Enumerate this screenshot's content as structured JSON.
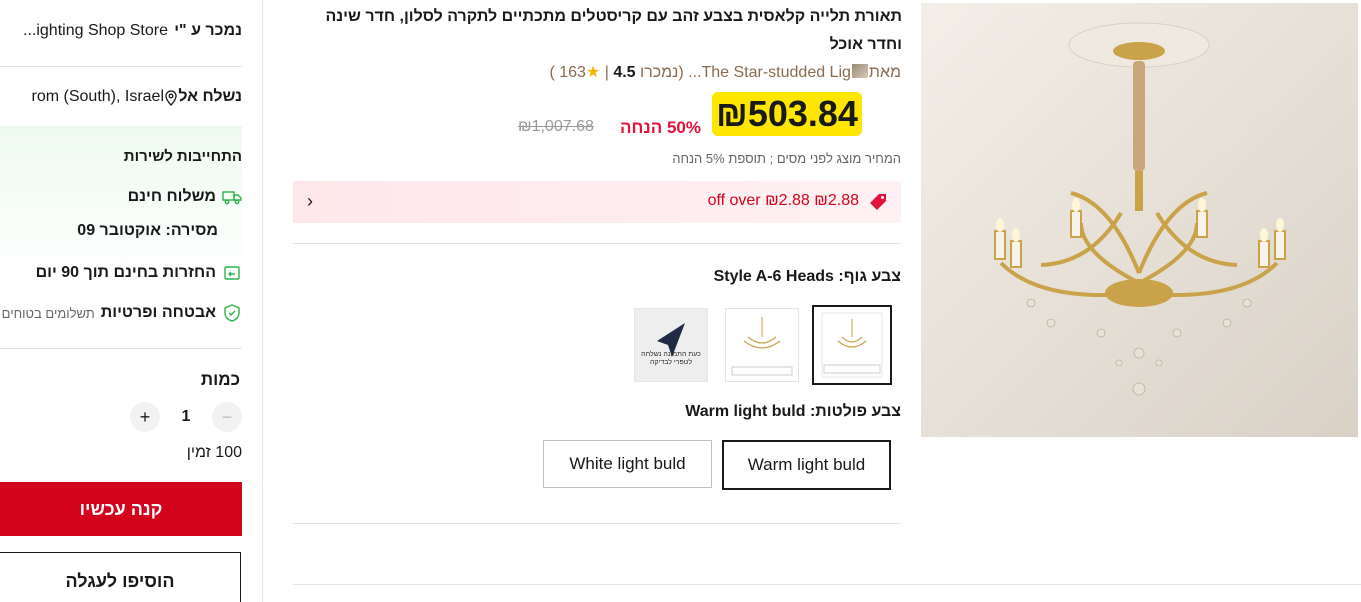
{
  "seller": {
    "label": "נמכר ע \"י",
    "name": "...ighting Shop Store"
  },
  "shipping": {
    "label": "נשלח אל",
    "destination": "rom (South), Israel",
    "icon": "location-pin-icon"
  },
  "service": {
    "title": "התחייבות לשירות",
    "free_shipping": "משלוח חינם",
    "delivery_label": "מסירה:",
    "delivery_date": "אוקטובר 09",
    "returns": "החזרות בחינם תוך 90 יום",
    "security": "אבטחה ופרטיות",
    "security_note": "תשלומים בטוחים"
  },
  "quantity": {
    "title": "כמות",
    "value": "1",
    "minus": "−",
    "plus": "+",
    "available": "100 זמין"
  },
  "actions": {
    "buy_now": "קנה עכשיו",
    "add_to_cart": "הוסיפו לעגלה"
  },
  "product": {
    "title": "תאורת תלייה קלאסית בצבע זהב עם קריסטלים מתכתיים לתקרה לסלון, חדר שינה וחדר אוכל",
    "byline_from": "מאת",
    "store": "The Star-studded Lig...",
    "rating": "4.5",
    "reviews": "163",
    "sold": "נמכרו",
    "price": "₪503.84",
    "discount": "50% הנחה",
    "original_price": "₪1,007.68",
    "tax_note": "המחיר מוצג לפני מסים ; תוספת 5% הנחה"
  },
  "coupon": {
    "text": "₪2.88 off over ₪2.88",
    "chevron": "›"
  },
  "options": {
    "body_color_label": "צבע גוף:",
    "body_color_value": "Style A-6 Heads",
    "swatch_note": "כעת התמונה נשלחה לטפרי לבדיקה",
    "bulb_color_label": "צבע פולטות:",
    "bulb_color_value": "Warm light buld",
    "bulbs": [
      "Warm light buld",
      "White light buld"
    ]
  },
  "colors": {
    "accent": "#d3031c",
    "price_highlight": "#ffe600",
    "discount": "#e3123a",
    "store_link": "#8b6b4f",
    "service_green": "#2db44a"
  }
}
